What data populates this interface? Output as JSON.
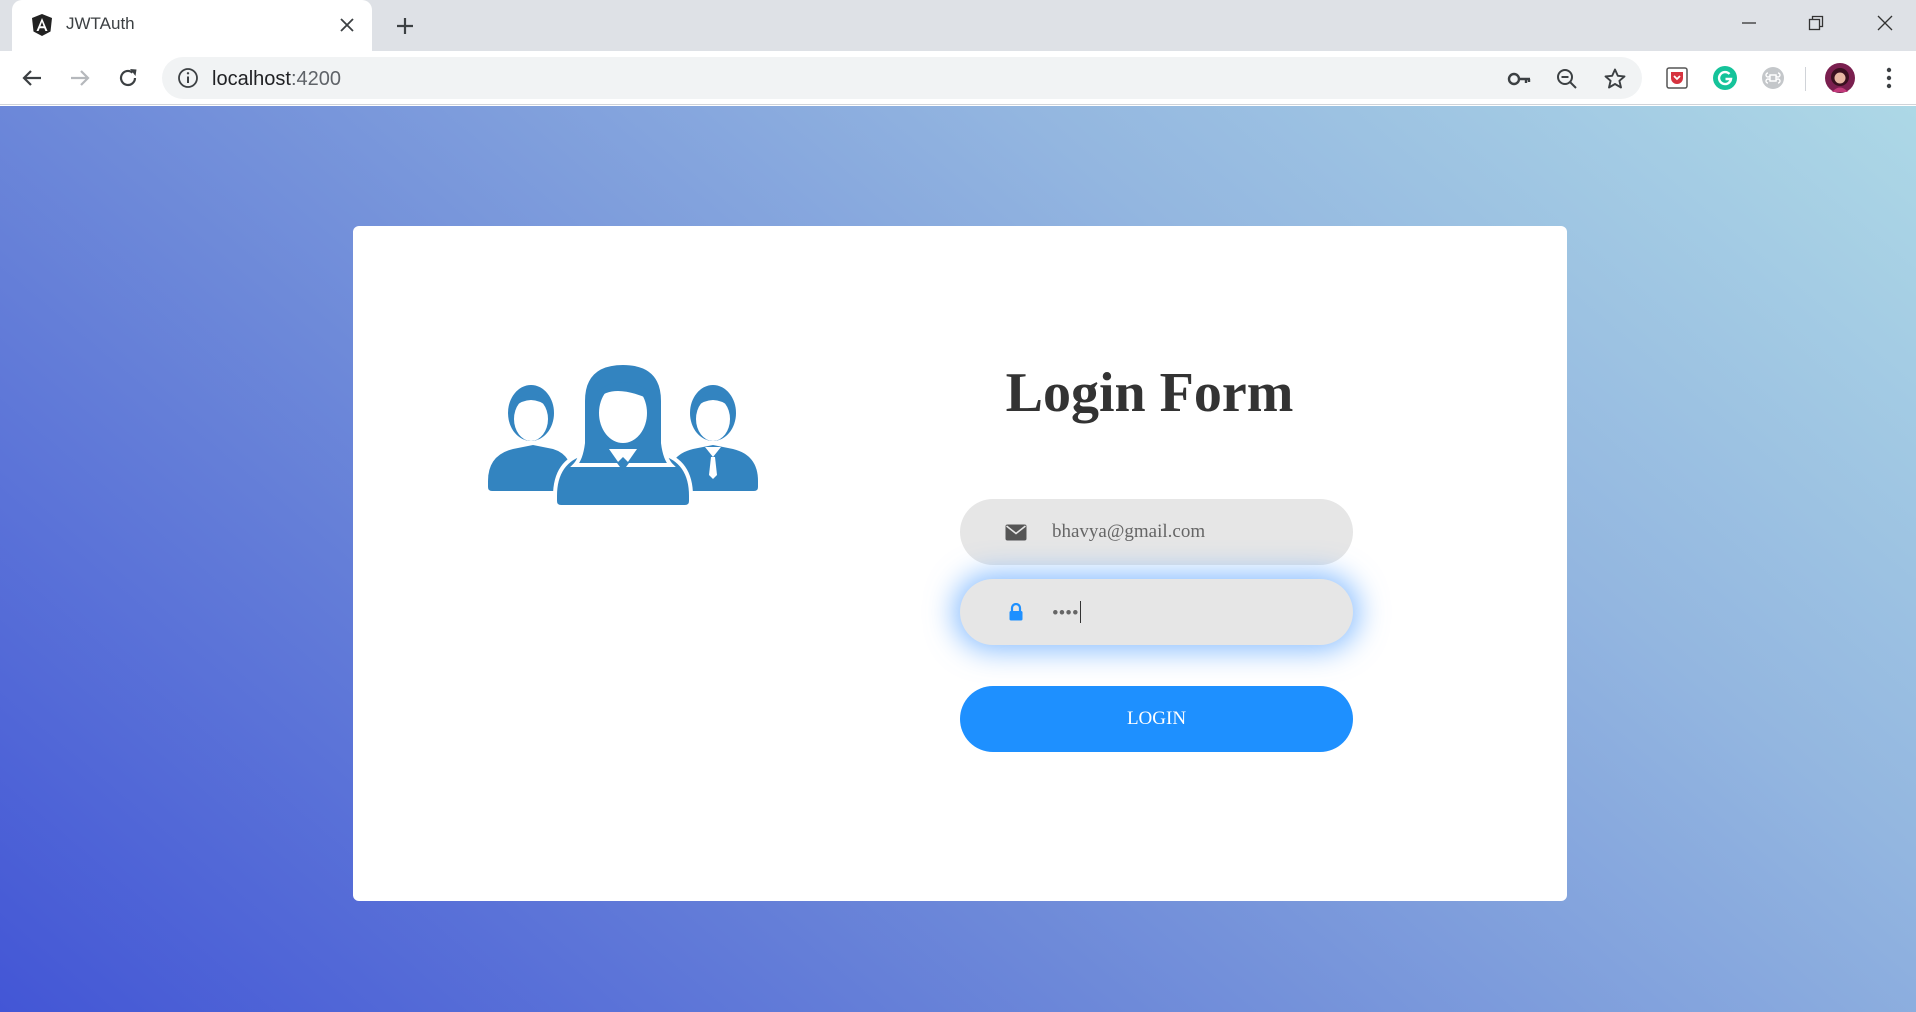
{
  "browser": {
    "tab": {
      "title": "JWTAuth",
      "favicon": "angular-logo-icon"
    },
    "address_bar": {
      "host": "localhost",
      "port": ":4200"
    },
    "colors": {
      "tabstrip": "#dee1e6",
      "omnibox": "#f1f3f4"
    }
  },
  "page": {
    "colors": {
      "gradient_start": "#4356d6",
      "gradient_end": "#add8e6",
      "accent": "#1e90ff",
      "icon_blue": "#3384c0"
    },
    "illustration": "users-group-icon",
    "form": {
      "title": "Login Form",
      "email": {
        "value": "bhavya@gmail.com",
        "icon": "envelope-icon"
      },
      "password": {
        "value": "••••",
        "icon": "lock-icon"
      },
      "submit_label": "LOGIN"
    }
  }
}
